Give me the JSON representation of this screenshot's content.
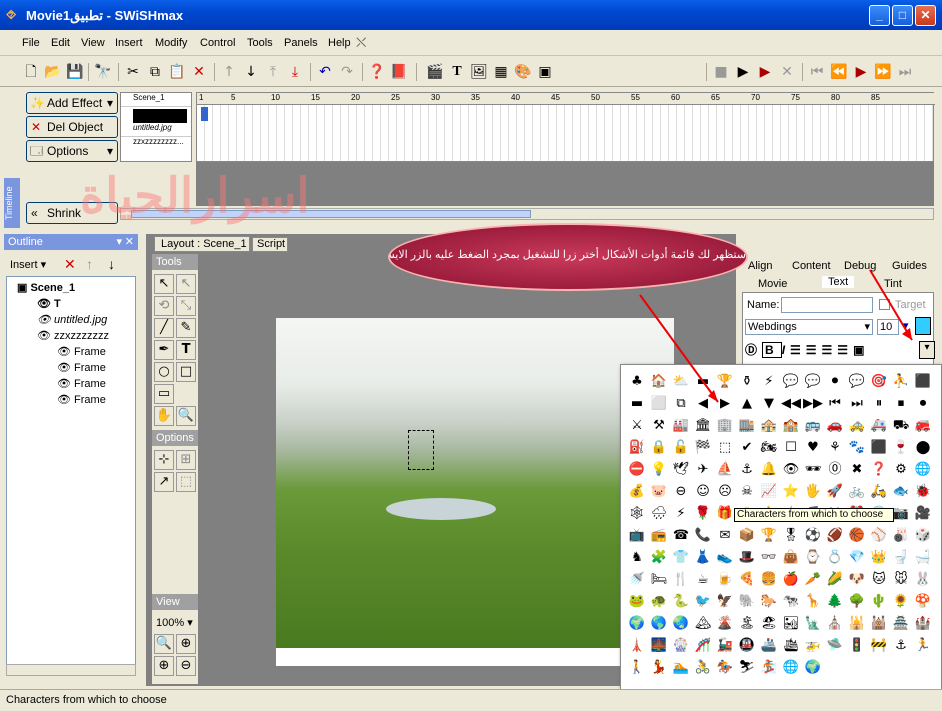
{
  "window": {
    "title": "Movie1تطبيق - SWiSHmax",
    "min": "_",
    "max": "□",
    "close": "✕"
  },
  "menu": [
    "File",
    "Edit",
    "View",
    "Insert",
    "Modify",
    "Control",
    "Tools",
    "Panels",
    "Help"
  ],
  "toolbar": {
    "icons": [
      "new-icon",
      "open-icon",
      "save-icon",
      "find-icon",
      "cut-icon",
      "copy-icon",
      "paste-icon",
      "delete-icon",
      "up-icon",
      "down-icon",
      "top-icon",
      "bottom-icon",
      "undo-icon",
      "redo-icon",
      "help-icon",
      "book-icon",
      "scene-icon",
      "text-icon",
      "image-icon",
      "sprite-icon",
      "content-icon",
      "play-scene-icon",
      "stop-icon",
      "play-icon",
      "play-effect-icon",
      "stop-effect-icon",
      "first-icon",
      "prev-icon",
      "next-icon",
      "last-icon"
    ]
  },
  "timeline": {
    "add_effect": "Add Effect",
    "del_object": "Del Object",
    "options": "Options",
    "shrink": "Shrink",
    "side_label": "Timeline",
    "rows": [
      "Scene_1",
      "",
      "untitled.jpg",
      "zzxzzzzzzzz..."
    ],
    "ticks": [
      "1",
      "5",
      "10",
      "15",
      "20",
      "25",
      "30",
      "35",
      "40",
      "45",
      "50",
      "55",
      "60",
      "65",
      "70",
      "75",
      "80",
      "85"
    ]
  },
  "outline": {
    "title": "Outline",
    "insert": "Insert",
    "tree": [
      {
        "label": "Scene_1",
        "bold": true,
        "indent": 0
      },
      {
        "label": "T",
        "bold": true,
        "indent": 1
      },
      {
        "label": "untitled.jpg",
        "italic": true,
        "indent": 1
      },
      {
        "label": "zzxzzzzzzz",
        "indent": 1
      },
      {
        "label": "Frame",
        "indent": 2
      },
      {
        "label": "Frame",
        "indent": 2
      },
      {
        "label": "Frame",
        "indent": 2
      },
      {
        "label": "Frame",
        "indent": 2
      }
    ]
  },
  "layout": {
    "tab1": "Layout : Scene_1",
    "tab2": "Script"
  },
  "tools": {
    "title": "Tools",
    "options_title": "Options",
    "view_title": "View",
    "zoom": "100%"
  },
  "right_panel": {
    "tabs_row1": [
      "Align",
      "Content",
      "Debug",
      "Guides"
    ],
    "tabs_row2": [
      "Movie",
      "Text",
      "Tint"
    ],
    "name_label": "Name:",
    "target_label": "Target",
    "font": "Webdings",
    "size": "10"
  },
  "annotation": {
    "callout": "ستظهر لك قائمة أدوات الأشكال أختر زرا للتشغيل بمجرد الضغط عليه بالزر الايسر ضغطة واحده",
    "watermark": "اسرارالحياة"
  },
  "char_picker": {
    "tooltip": "Characters from which to choose",
    "chars": [
      "♣",
      "🏠",
      "⛅",
      "▬",
      "🏆",
      "⚱",
      "⚡",
      "💬",
      "💬",
      "⚫",
      "💬",
      "🎯",
      "⛹",
      "⬛",
      "▬",
      "⬜",
      "⧉",
      "◀",
      "▶",
      "▲",
      "▼",
      "◀◀",
      "▶▶",
      "⏮",
      "⏭",
      "⏸",
      "⏹",
      "⏺",
      "⚔",
      "⚒",
      "🏭",
      "🏛",
      "🏢",
      "🏬",
      "🏤",
      "🏫",
      "🚌",
      "🚗",
      "🚕",
      "🚑",
      "⛟",
      "🚒",
      "⛽",
      "🔒",
      "🔓",
      "🏁",
      "⬚",
      "✔",
      "🏍",
      "☐",
      "♥",
      "⚘",
      "🐾",
      "⬛",
      "🍷",
      "⬤",
      "⛔",
      "💡",
      "🕊",
      "✈",
      "⛵",
      "⚓",
      "🔔",
      "👁",
      "🕶",
      "⓪",
      "✖",
      "❓",
      "⚙",
      "🌐",
      "💰",
      "🐷",
      "⊖",
      "☺",
      "☹",
      "☠",
      "📈",
      "⭐",
      "🖐",
      "🚀",
      "🚲",
      "🛵",
      "🐟",
      "🐞",
      "🕸",
      "🌧",
      "⚡",
      "🌹",
      "🎁",
      "🎂",
      "🎄",
      "🕯",
      "🎵",
      "🎮",
      "⏰",
      "💿",
      "📷",
      "🎥",
      "📺",
      "📻",
      "☎",
      "📞",
      "✉",
      "📦",
      "🏆",
      "🎖",
      "⚽",
      "🏈",
      "🏀",
      "⚾",
      "🎳",
      "🎲",
      "♞",
      "🧩",
      "👕",
      "👗",
      "👟",
      "🎩",
      "👓",
      "👜",
      "⌚",
      "💍",
      "💎",
      "👑",
      "🚽",
      "🛁",
      "🚿",
      "🛏",
      "🍴",
      "☕",
      "🍺",
      "🍕",
      "🍔",
      "🍎",
      "🥕",
      "🌽",
      "🐶",
      "🐱",
      "🐭",
      "🐰",
      "🐸",
      "🐢",
      "🐍",
      "🐦",
      "🦅",
      "🐘",
      "🐎",
      "🐄",
      "🦒",
      "🌲",
      "🌳",
      "🌵",
      "🌻",
      "🍄",
      "🌍",
      "🌎",
      "🌏",
      "🏔",
      "🌋",
      "🏝",
      "🏖",
      "🏜",
      "🗽",
      "⛪",
      "🕌",
      "🕍",
      "🏯",
      "🏰",
      "🗼",
      "🌉",
      "🎡",
      "🎢",
      "🚂",
      "🚇",
      "🚢",
      "🛳",
      "🚁",
      "🛸",
      "🚦",
      "🚧",
      "⚓",
      "🏃",
      "🚶",
      "💃",
      "🏊",
      "🚴",
      "🏇",
      "⛷",
      "🏂",
      "🌐",
      "🌍"
    ]
  },
  "status": {
    "text": "Characters from which to choose"
  }
}
